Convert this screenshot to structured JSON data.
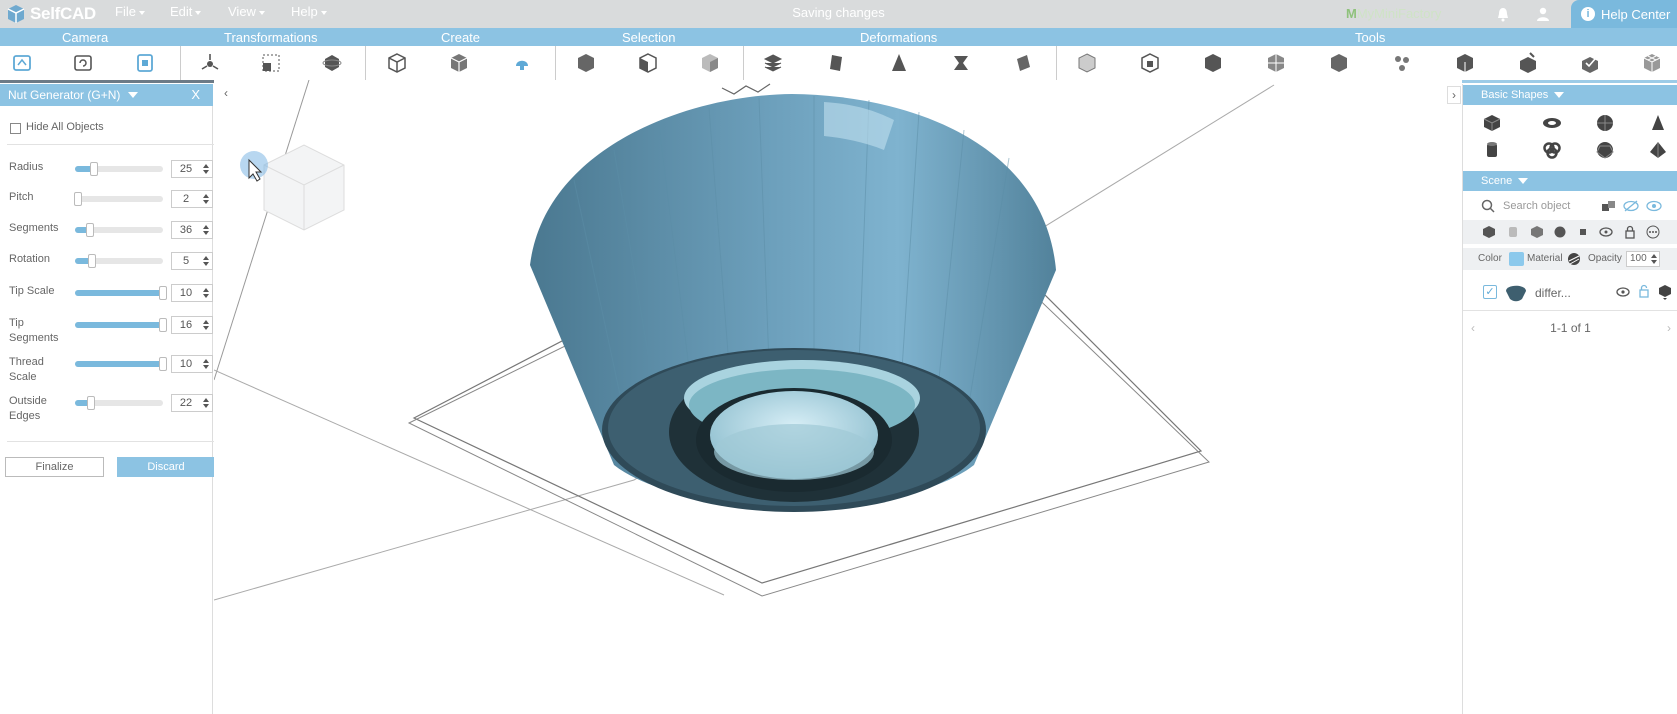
{
  "app": {
    "name": "SelfCAD",
    "status": "Saving changes"
  },
  "menu": [
    "File",
    "Edit",
    "View",
    "Help"
  ],
  "header_right": {
    "brand": "MyMiniFactory",
    "help": "Help Center"
  },
  "groups": [
    "Camera",
    "Transformations",
    "Create",
    "Selection",
    "Deformations",
    "Tools"
  ],
  "panel": {
    "title": "Nut Generator (G+N)",
    "close": "X",
    "hide_all": "Hide All Objects",
    "params": [
      {
        "label": "Radius",
        "value": "25",
        "level": 0.18
      },
      {
        "label": "Pitch",
        "value": "2",
        "level": 0.0
      },
      {
        "label": "Segments",
        "value": "36",
        "level": 0.14
      },
      {
        "label": "Rotation",
        "value": "5",
        "level": 0.17
      },
      {
        "label": "Tip Scale",
        "value": "10",
        "level": 1.0
      },
      {
        "label": "Tip Segments",
        "value": "16",
        "level": 1.0
      },
      {
        "label": "Thread Scale",
        "value": "10",
        "level": 1.0
      },
      {
        "label": "Outside Edges",
        "value": "22",
        "level": 0.15
      }
    ],
    "finalize": "Finalize",
    "discard": "Discard"
  },
  "right": {
    "basic_shapes": "Basic Shapes",
    "scene": "Scene",
    "search_placeholder": "Search object",
    "color_label": "Color",
    "material_label": "Material",
    "opacity_label": "Opacity",
    "opacity_value": "100",
    "object_name": "differ...",
    "pager": "1-1 of 1"
  },
  "colors": {
    "accent": "#8cc3e3",
    "model": "#5f93ad",
    "menubar": "#d9dbdc"
  }
}
